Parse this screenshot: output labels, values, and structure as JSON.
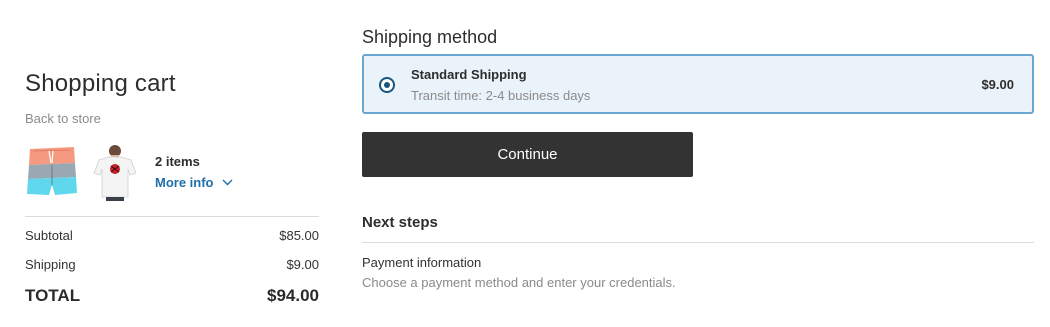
{
  "cart": {
    "title": "Shopping cart",
    "back_link": "Back to store",
    "items_count": "2 items",
    "more_info": "More info",
    "thumbnails": [
      {
        "icon": "board-shorts-image",
        "colors": [
          "#f59a80",
          "#9aa8b3",
          "#5fd8ee"
        ]
      },
      {
        "icon": "tshirt-image",
        "colors": [
          "#f4f4f4",
          "#c8202a"
        ]
      }
    ]
  },
  "summary": {
    "subtotal_label": "Subtotal",
    "subtotal_value": "$85.00",
    "shipping_label": "Shipping",
    "shipping_value": "$9.00",
    "total_label": "TOTAL",
    "total_value": "$94.00"
  },
  "shipping_method": {
    "heading": "Shipping method",
    "option": {
      "name": "Standard Shipping",
      "transit": "Transit time: 2-4 business days",
      "price": "$9.00",
      "selected": true
    }
  },
  "continue_label": "Continue",
  "next_steps": {
    "heading": "Next steps",
    "step_title": "Payment information",
    "step_desc": "Choose a payment method and enter your credentials."
  },
  "colors": {
    "accent_blue": "#1f6fa8",
    "option_bg": "#eaf3fa",
    "option_border": "#6aa6d0",
    "button_bg": "#333333"
  }
}
